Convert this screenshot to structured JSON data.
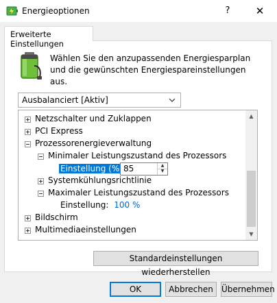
{
  "window": {
    "title": "Energieoptionen",
    "help_glyph": "?",
    "close_glyph": "✕"
  },
  "tab": {
    "label": "Erweiterte Einstellungen"
  },
  "description": "Wählen Sie den anzupassenden Energiesparplan und die gewünschten Energiespareinstellungen aus.",
  "plan_select": {
    "value": "Ausbalanciert [Aktiv]"
  },
  "tree": {
    "items": [
      {
        "label": "Netzschalter und Zuklappen",
        "expanded": false
      },
      {
        "label": "PCI Express",
        "expanded": false
      },
      {
        "label": "Prozessorenergieverwaltung",
        "expanded": true
      },
      {
        "label": "Minimaler Leistungszustand des Prozessors",
        "expanded": true
      },
      {
        "label": "Einstellung (%):",
        "value": "85"
      },
      {
        "label": "Systemkühlungsrichtlinie",
        "expanded": false
      },
      {
        "label": "Maximaler Leistungszustand des Prozessors",
        "expanded": true
      },
      {
        "label": "Einstellung:",
        "value": "100 %"
      },
      {
        "label": "Bildschirm",
        "expanded": false
      },
      {
        "label": "Multimediaeinstellungen",
        "expanded": false
      }
    ]
  },
  "buttons": {
    "restore": "Standardeinstellungen wiederherstellen",
    "ok": "OK",
    "cancel": "Abbrechen",
    "apply": "Übernehmen"
  },
  "colors": {
    "accent": "#0078d7",
    "link": "#0066cc",
    "battery": "#7cc142"
  }
}
